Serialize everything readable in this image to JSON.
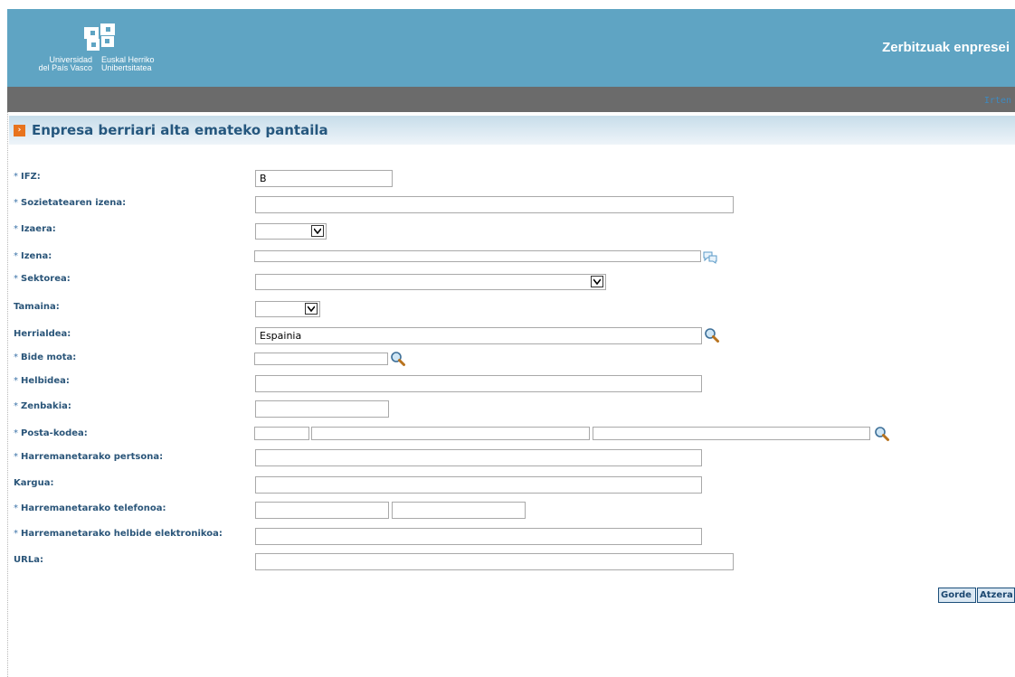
{
  "header": {
    "logo_es": [
      "Universidad",
      "del País Vasco"
    ],
    "logo_eu": [
      "Euskal Herriko",
      "Unibertsitatea"
    ],
    "title": "Zerbitzuak enpresei",
    "logout": "Irten"
  },
  "page": {
    "title": "Enpresa berriari alta emateko pantaila"
  },
  "form": {
    "required_mark": "*",
    "labels": {
      "ifz": "IFZ:",
      "sozietatea": "Sozietatearen izena:",
      "izaera": "Izaera:",
      "izena": "Izena:",
      "sektorea": "Sektorea:",
      "tamaina": "Tamaina:",
      "herrialdea": "Herrialdea:",
      "bide_mota": "Bide mota:",
      "helbidea": "Helbidea:",
      "zenbakia": "Zenbakia:",
      "posta_kodea": "Posta-kodea:",
      "pertsona": "Harremanetarako pertsona:",
      "kargua": "Kargua:",
      "telefonoa": "Harremanetarako telefonoa:",
      "email": "Harremanetarako helbide elektronikoa:",
      "url": "URLa:"
    },
    "values": {
      "ifz": "B",
      "herrialdea": "Espainia"
    }
  },
  "buttons": {
    "save": "Gorde",
    "back": "Atzera"
  },
  "colors": {
    "header": "#5fa4c3",
    "bar": "#6b6b6b",
    "label": "#2a5579",
    "accent": "#e8741e"
  }
}
